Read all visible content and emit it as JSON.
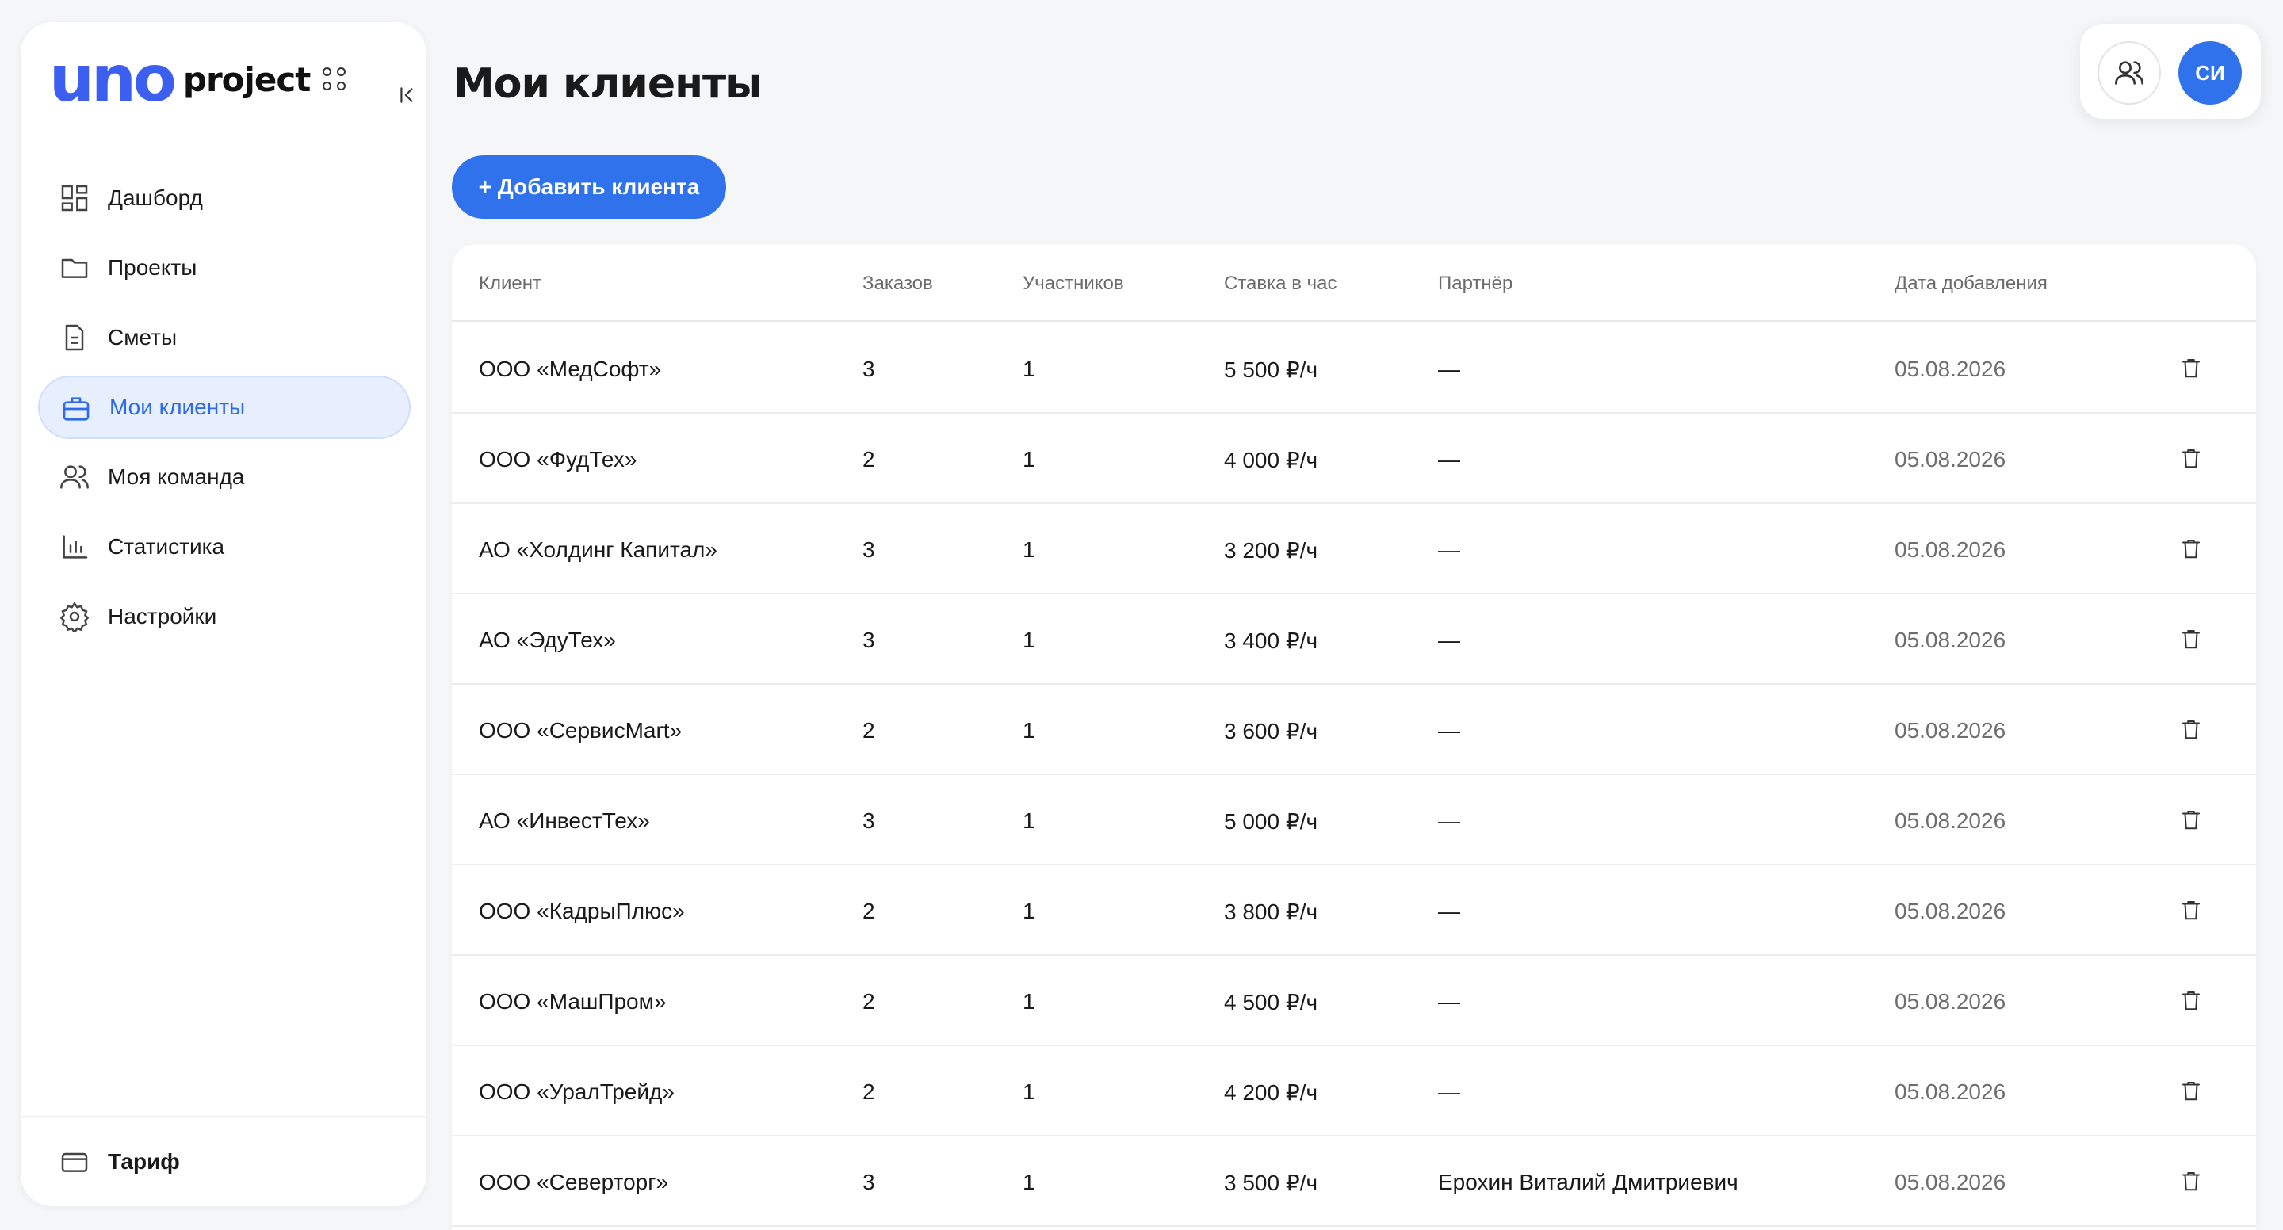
{
  "brand": {
    "mark": "uno",
    "name": "project"
  },
  "sidebar": {
    "items": [
      {
        "label": "Дашборд",
        "icon": "dashboard-icon"
      },
      {
        "label": "Проекты",
        "icon": "folder-icon"
      },
      {
        "label": "Сметы",
        "icon": "document-icon"
      },
      {
        "label": "Мои клиенты",
        "icon": "briefcase-icon",
        "active": true
      },
      {
        "label": "Моя команда",
        "icon": "team-icon"
      },
      {
        "label": "Статистика",
        "icon": "bar-chart-icon"
      },
      {
        "label": "Настройки",
        "icon": "gear-icon"
      }
    ],
    "tariff": "Тариф"
  },
  "header": {
    "title": "Мои клиенты",
    "add_button": "+ Добавить клиента",
    "avatar_initials": "СИ"
  },
  "colors": {
    "accent": "#2f72ec",
    "active_bg": "#e7efff"
  },
  "table": {
    "columns": [
      "Клиент",
      "Заказов",
      "Участников",
      "Ставка в час",
      "Партнёр",
      "Дата добавления"
    ],
    "rows": [
      {
        "client": "ООО «МедСофт»",
        "orders": "3",
        "members": "1",
        "rate": "5 500 ₽/ч",
        "partner": "—",
        "date": "05.08.2026"
      },
      {
        "client": "ООО «ФудТех»",
        "orders": "2",
        "members": "1",
        "rate": "4 000 ₽/ч",
        "partner": "—",
        "date": "05.08.2026"
      },
      {
        "client": "АО «Холдинг Капитал»",
        "orders": "3",
        "members": "1",
        "rate": "3 200 ₽/ч",
        "partner": "—",
        "date": "05.08.2026"
      },
      {
        "client": "АО «ЭдуТех»",
        "orders": "3",
        "members": "1",
        "rate": "3 400 ₽/ч",
        "partner": "—",
        "date": "05.08.2026"
      },
      {
        "client": "ООО «СервисMart»",
        "orders": "2",
        "members": "1",
        "rate": "3 600 ₽/ч",
        "partner": "—",
        "date": "05.08.2026"
      },
      {
        "client": "АО «ИнвестТех»",
        "orders": "3",
        "members": "1",
        "rate": "5 000 ₽/ч",
        "partner": "—",
        "date": "05.08.2026"
      },
      {
        "client": "ООО «КадрыПлюс»",
        "orders": "2",
        "members": "1",
        "rate": "3 800 ₽/ч",
        "partner": "—",
        "date": "05.08.2026"
      },
      {
        "client": "ООО «МашПром»",
        "orders": "2",
        "members": "1",
        "rate": "4 500 ₽/ч",
        "partner": "—",
        "date": "05.08.2026"
      },
      {
        "client": "ООО «УралТрейд»",
        "orders": "2",
        "members": "1",
        "rate": "4 200 ₽/ч",
        "partner": "—",
        "date": "05.08.2026"
      },
      {
        "client": "ООО «Северторг»",
        "orders": "3",
        "members": "1",
        "rate": "3 500 ₽/ч",
        "partner": "Ерохин Виталий Дмитриевич",
        "date": "05.08.2026"
      }
    ]
  }
}
